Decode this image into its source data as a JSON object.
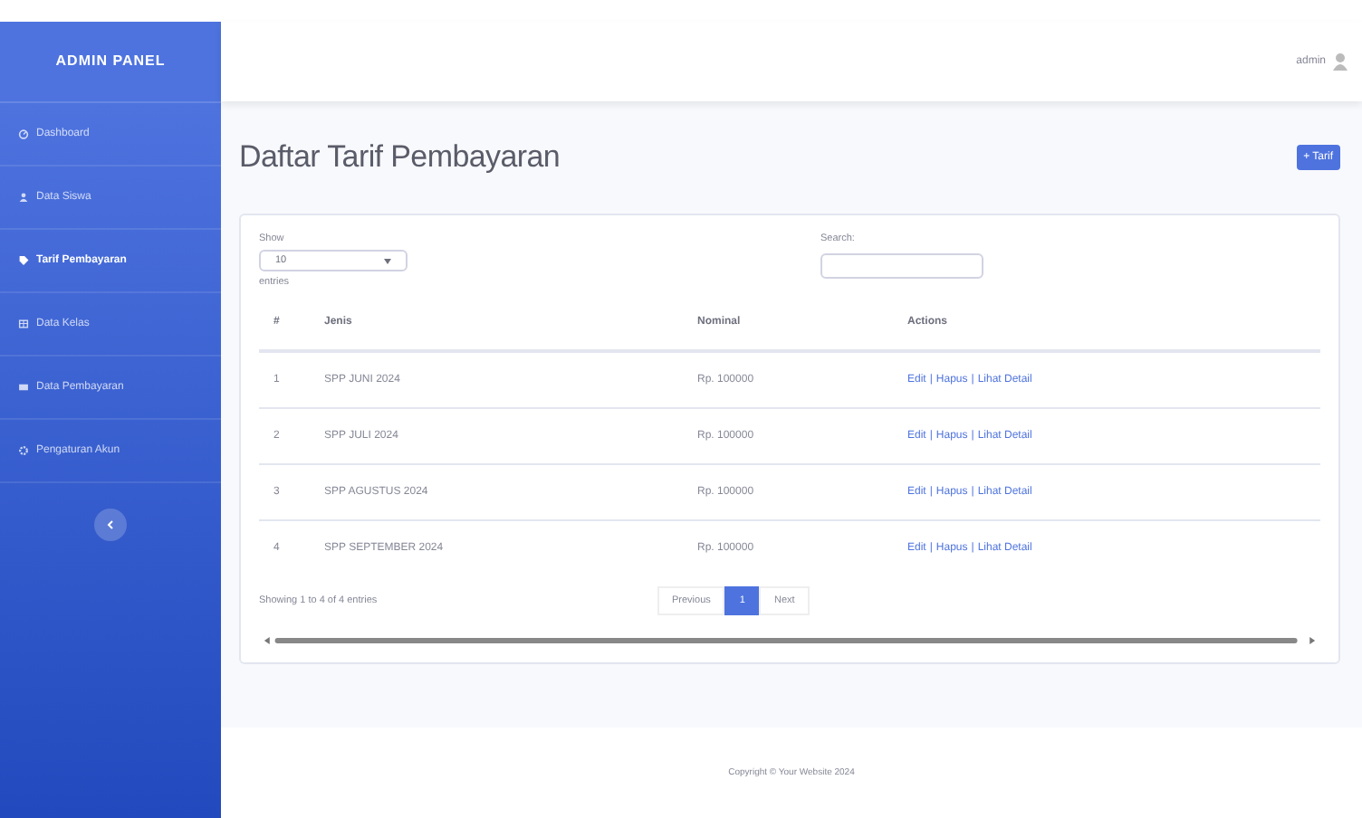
{
  "sidebar": {
    "brand": "ADMIN PANEL",
    "items": [
      {
        "label": "Dashboard",
        "selected": false
      },
      {
        "label": "Data Siswa",
        "selected": false
      },
      {
        "label": "Tarif Pembayaran",
        "selected": true
      },
      {
        "label": "Data Kelas",
        "selected": false
      },
      {
        "label": "Data Pembayaran",
        "selected": false
      },
      {
        "label": "Pengaturan Akun",
        "selected": false
      }
    ]
  },
  "topbar": {
    "user": "admin"
  },
  "page": {
    "title": "Daftar Tarif Pembayaran",
    "add_button": "+ Tarif"
  },
  "table_controls": {
    "show_label": "Show",
    "show_value": "10",
    "entries_label": "entries",
    "search_label": "Search:"
  },
  "table": {
    "columns": [
      "#",
      "Jenis",
      "Nominal",
      "Actions"
    ],
    "rows": [
      {
        "no": "1",
        "jenis": "SPP JUNI 2024",
        "nominal": "Rp. 100000",
        "actions": [
          "Edit",
          "|",
          "Hapus",
          "|",
          "Lihat Detail"
        ]
      },
      {
        "no": "2",
        "jenis": "SPP JULI 2024",
        "nominal": "Rp. 100000",
        "actions": [
          "Edit",
          "|",
          "Hapus",
          "|",
          "Lihat Detail"
        ]
      },
      {
        "no": "3",
        "jenis": "SPP AGUSTUS 2024",
        "nominal": "Rp. 100000",
        "actions": [
          "Edit",
          "|",
          "Hapus",
          "|",
          "Lihat Detail"
        ]
      },
      {
        "no": "4",
        "jenis": "SPP SEPTEMBER 2024",
        "nominal": "Rp. 100000",
        "actions": [
          "Edit",
          "|",
          "Hapus",
          "|",
          "Lihat Detail"
        ]
      }
    ]
  },
  "footer_info": "Showing 1 to 4 of 4 entries",
  "pagination": [
    {
      "label": "Previous",
      "selected": false
    },
    {
      "label": "1",
      "selected": true
    },
    {
      "label": "Next",
      "selected": false
    }
  ],
  "footer": "Copyright © Your Website 2024"
}
